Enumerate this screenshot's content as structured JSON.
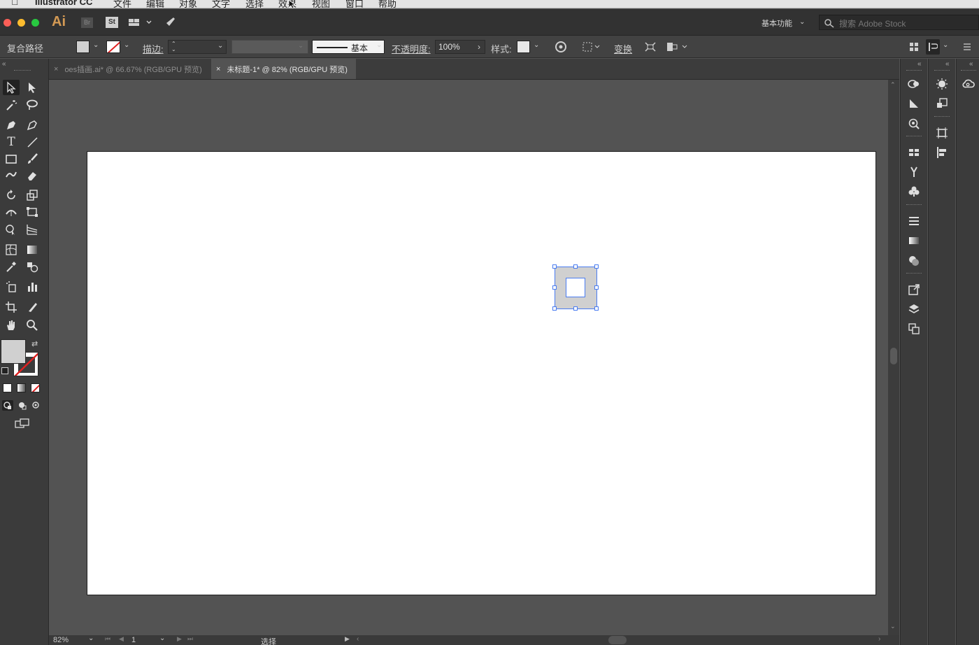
{
  "menubar": {
    "app_name": "Illustrator CC",
    "items": [
      "文件",
      "编辑",
      "对象",
      "文字",
      "选择",
      "效果",
      "视图",
      "窗口",
      "帮助"
    ]
  },
  "appbar": {
    "logo": "Ai",
    "bridge": "Br",
    "stock_btn": "St",
    "workspace": "基本功能",
    "search_placeholder": "搜索 Adobe Stock"
  },
  "control": {
    "object_type": "复合路径",
    "stroke_label": "描边:",
    "stroke_style": "基本",
    "opacity_label": "不透明度:",
    "opacity_value": "100%",
    "style_label": "样式:",
    "transform_label": "变换"
  },
  "tabs": [
    {
      "title": "oes插画.ai* @ 66.67% (RGB/GPU 预览)",
      "active": false
    },
    {
      "title": "未标题-1* @ 82% (RGB/GPU 预览)",
      "active": true
    }
  ],
  "status": {
    "zoom": "82%",
    "artboard": "1",
    "tool": "选择"
  },
  "colors": {
    "fill": "#d0d0d0",
    "selection": "#4a7cf0",
    "accent": "#d49a54"
  }
}
